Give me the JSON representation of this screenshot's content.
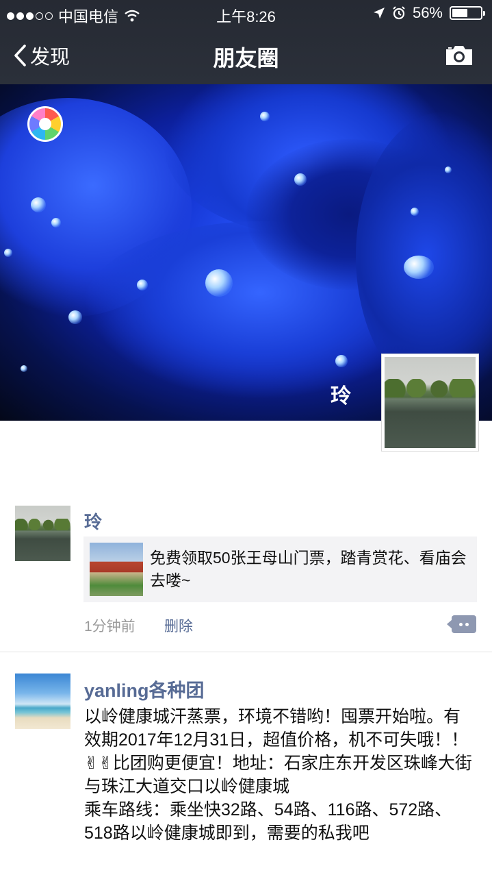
{
  "status_bar": {
    "carrier": "中国电信",
    "time": "上午8:26",
    "battery_percent": "56%",
    "battery_level": 0.56,
    "signal_bars_filled": 3,
    "signal_bars_total": 5
  },
  "nav": {
    "back_label": "发现",
    "title": "朋友圈"
  },
  "cover": {
    "owner_name": "玲"
  },
  "posts": [
    {
      "author": "玲",
      "share_text": "免费领取50张王母山门票，踏青赏花、看庙会去喽~",
      "time": "1分钟前",
      "delete_label": "删除"
    },
    {
      "author": "yanling各种团",
      "text": "以岭健康城汗蒸票，环境不错哟！囤票开始啦。有效期2017年12月31日，超值价格，机不可失哦！！✌✌比团购更便宜！地址：石家庄东开发区珠峰大街与珠江大道交口以岭健康城\n乘车路线：乘坐快32路、54路、116路、572路、518路以岭健康城即到，需要的私我吧"
    }
  ],
  "colors": {
    "link": "#576b95",
    "nav_bg": "#2b303a",
    "share_bg": "#f3f3f5"
  },
  "icons": [
    "back-chevron-icon",
    "camera-icon",
    "wifi-icon",
    "location-arrow-icon",
    "alarm-icon",
    "battery-icon",
    "comment-icon"
  ]
}
